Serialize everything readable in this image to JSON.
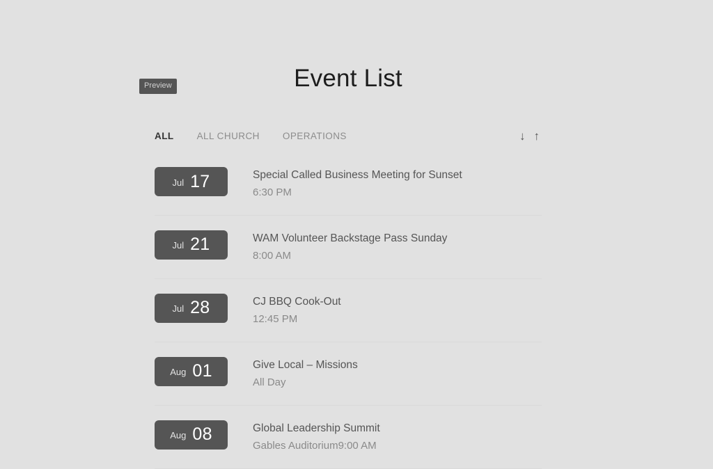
{
  "preview_badge": {
    "label": "Preview"
  },
  "header": {
    "title": "Event List"
  },
  "filter_bar": {
    "tabs": [
      {
        "label": "ALL",
        "active": true
      },
      {
        "label": "ALL CHURCH",
        "active": false
      },
      {
        "label": "OPERATIONS",
        "active": false
      }
    ],
    "sort_controls": [
      {
        "name": "sort-descending-icon",
        "glyph": "↓"
      },
      {
        "name": "sort-ascending-icon",
        "glyph": "↑"
      }
    ]
  },
  "events": [
    {
      "month": "Jul",
      "day": "17",
      "title": "Special Called Business Meeting for Sunset",
      "meta": "6:30 PM"
    },
    {
      "month": "Jul",
      "day": "21",
      "title": "WAM Volunteer Backstage Pass Sunday",
      "meta": "8:00 AM"
    },
    {
      "month": "Jul",
      "day": "28",
      "title": "CJ BBQ Cook-Out",
      "meta": "12:45 PM"
    },
    {
      "month": "Aug",
      "day": "01",
      "title": "Give Local – Missions",
      "meta": "All Day"
    },
    {
      "month": "Aug",
      "day": "08",
      "title": "Global Leadership Summit",
      "meta": "Gables Auditorium9:00 AM"
    }
  ],
  "colors": {
    "page_background": "#e1e1e1",
    "chip_background": "#555555",
    "title_text": "#1d1d1d",
    "event_title_text": "#555555",
    "event_meta_text": "#8a8a8a",
    "tab_inactive_text": "#8c8c8c",
    "tab_active_text": "#333333",
    "divider": "#dadada"
  }
}
